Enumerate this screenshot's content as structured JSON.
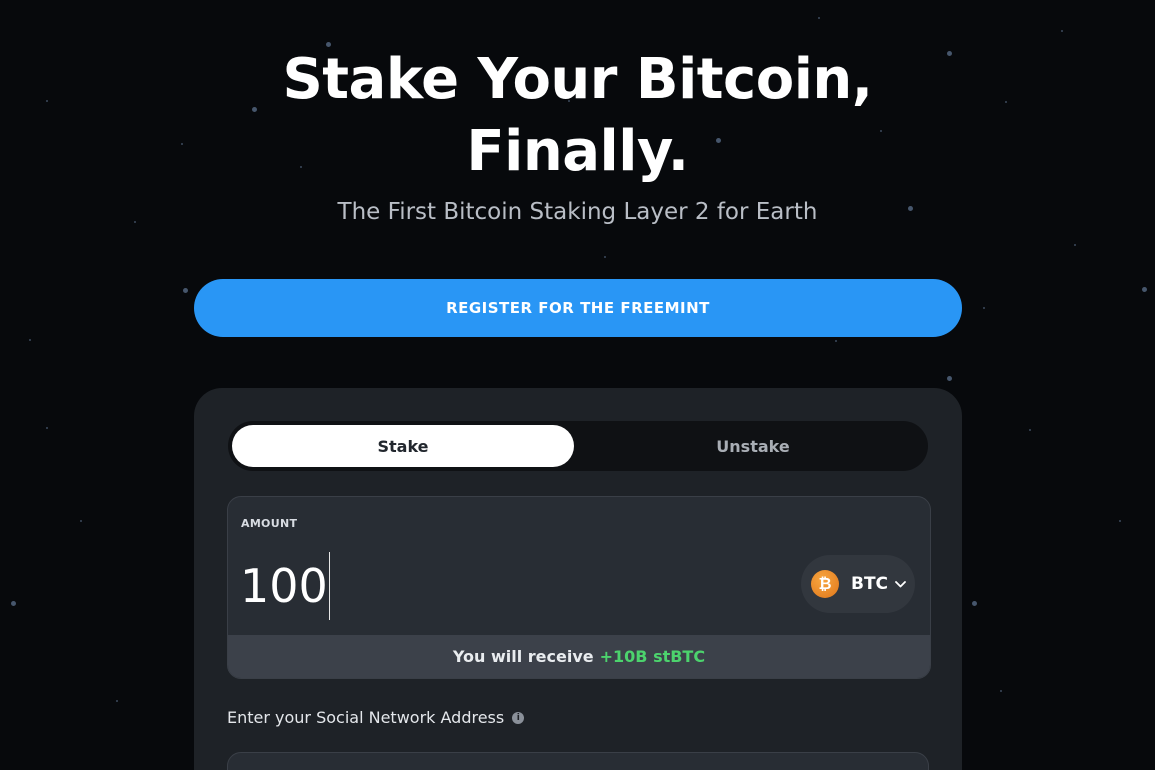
{
  "hero": {
    "title_line1": "Stake Your Bitcoin,",
    "title_line2": "Finally.",
    "subtitle": "The First Bitcoin Staking Layer 2 for Earth"
  },
  "register_button": {
    "label": "REGISTER FOR THE FREEMINT"
  },
  "tabs": [
    {
      "label": "Stake",
      "active": true
    },
    {
      "label": "Unstake",
      "active": false
    }
  ],
  "amount": {
    "label": "AMOUNT",
    "value": "100",
    "token": {
      "name": "BTC",
      "icon": "bitcoin-icon",
      "symbol": "₿"
    }
  },
  "receive": {
    "prefix": "You will receive",
    "value": "+10B stBTC"
  },
  "social": {
    "label": "Enter your Social Network Address",
    "info_icon": "info-icon"
  },
  "colors": {
    "background": "#07090c",
    "accent": "#2996f5",
    "panel": "#1e2227",
    "receive_highlight": "#4cd36d"
  }
}
